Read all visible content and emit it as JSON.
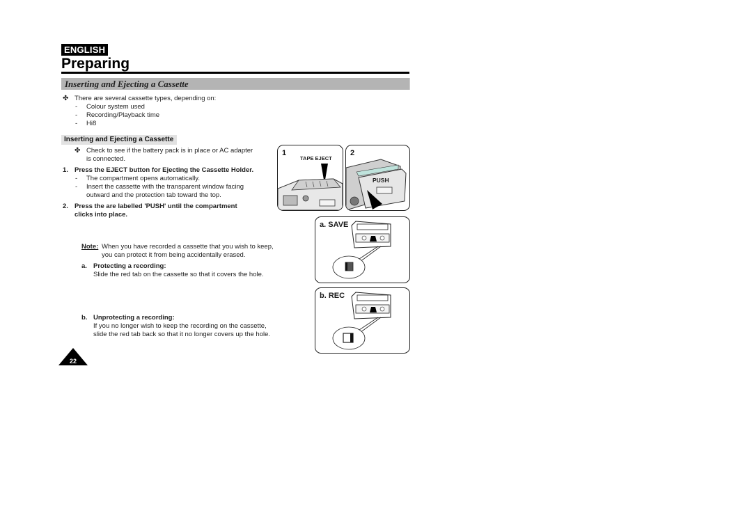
{
  "header": {
    "language_badge": "ENGLISH",
    "page_title": "Preparing",
    "section_title": "Inserting and Ejecting a Cassette"
  },
  "intro": {
    "bullet": "There are several cassette types, depending on:",
    "items": [
      "Colour system used",
      "Recording/Playback time",
      "Hi8"
    ]
  },
  "subsection": {
    "title": "Inserting and Ejecting a Cassette",
    "check_line1": "Check to see if the battery pack is in place or AC adapter",
    "check_line2": "is connected.",
    "step1": {
      "num": "1.",
      "title": "Press the EJECT button for Ejecting the Cassette Holder.",
      "items": [
        "The compartment opens automatically.",
        "Insert the cassette with the transparent window facing",
        "outward and the protection tab toward the top."
      ]
    },
    "step2": {
      "num": "2.",
      "line1": "Press the are labelled 'PUSH' until the compartment",
      "line2": "clicks into place."
    }
  },
  "note": {
    "label": "Note:",
    "line1": "When you have recorded a cassette that you wish to keep,",
    "line2": "you can protect it from being accidentally erased.",
    "a": {
      "marker": "a.",
      "title": "Protecting a recording:",
      "text": "Slide the red tab on the cassette so that it covers the hole."
    },
    "b": {
      "marker": "b.",
      "title": "Unprotecting a recording:",
      "line1": "If you no longer wish to keep the recording on the cassette,",
      "line2": "slide the red tab back so that it no longer covers up the hole."
    }
  },
  "figures": {
    "panel1": {
      "num": "1",
      "label": "TAPE EJECT"
    },
    "panel2": {
      "num": "2",
      "label": "PUSH"
    },
    "save": {
      "label": "a. SAVE"
    },
    "rec": {
      "label": "b. REC"
    }
  },
  "footer": {
    "page_number": "22"
  }
}
